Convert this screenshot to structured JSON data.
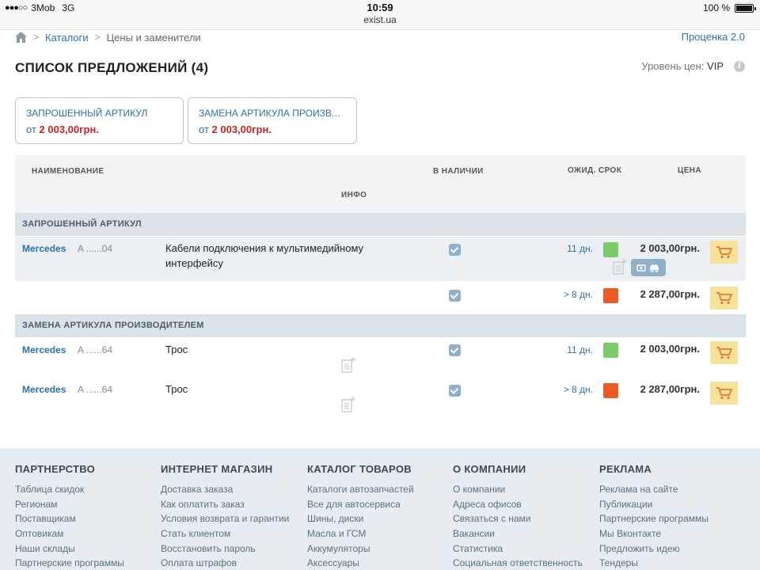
{
  "status": {
    "carrier": "3Mob",
    "network": "3G",
    "time": "10:59",
    "url": "exist.ua",
    "battery": "100 %"
  },
  "breadcrumb": {
    "items": [
      "Каталоги",
      "Цены и заменители"
    ],
    "right_link": "Проценка 2.0"
  },
  "header": {
    "title": "СПИСОК ПРЕДЛОЖЕНИЙ (4)",
    "price_level_label": "Уровень цен:",
    "price_level_value": "VIP"
  },
  "cards": [
    {
      "title": "ЗАПРОШЕННЫЙ АРТИКУЛ",
      "price_prefix": "от",
      "price": "2 003,00грн."
    },
    {
      "title": "ЗАМЕНА АРТИКУЛА ПРОИЗВОД...",
      "price_prefix": "от",
      "price": "2 003,00грн."
    }
  ],
  "table": {
    "columns": {
      "name": "НАИМЕНОВАНИЕ",
      "stock": "В НАЛИЧИИ",
      "term": "ОЖИД. СРОК",
      "price": "ЦЕНА",
      "info": "ИНФО"
    },
    "groups": [
      {
        "title": "ЗАПРОШЕННЫЙ АРТИКУЛ",
        "rows": [
          {
            "brand": "Mercedes",
            "sku": "A ......04",
            "description": "Кабели подключения к мультимедийному интерфейсу",
            "term": "11 дн.",
            "status_color": "#7ccb6b",
            "price": "2 003,00грн.",
            "in_stock": true
          },
          {
            "brand": "",
            "sku": "",
            "description": "",
            "term": "> 8 дн.",
            "status_color": "#ea5a25",
            "price": "2 287,00грн.",
            "in_stock": true
          }
        ]
      },
      {
        "title": "ЗАМЕНА АРТИКУЛА ПРОИЗВОДИТЕЛЕМ",
        "rows": [
          {
            "brand": "Mercedes",
            "sku": "A ......64",
            "description": "Трос",
            "term": "11 дн.",
            "status_color": "#7ccb6b",
            "price": "2 003,00грн.",
            "in_stock": true
          },
          {
            "brand": "Mercedes",
            "sku": "A ......64",
            "description": "Трос",
            "term": "> 8 дн.",
            "status_color": "#ea5a25",
            "price": "2 287,00грн.",
            "in_stock": true
          }
        ]
      }
    ]
  },
  "footer": {
    "columns": [
      {
        "title": "ПАРТНЕРСТВО",
        "links": [
          "Таблица скидок",
          "Регионам",
          "Поставщикам",
          "Оптовикам",
          "Наши склады",
          "Партнерские программы"
        ]
      },
      {
        "title": "ИНТЕРНЕТ МАГАЗИН",
        "links": [
          "Доставка заказа",
          "Как оплатить заказ",
          "Условия возврата и гарантии",
          "Стать клиентом",
          "Восстановить пароль",
          "Оплата штрафов"
        ]
      },
      {
        "title": "КАТАЛОГ ТОВАРОВ",
        "links": [
          "Каталоги автозапчастей",
          "Все для автосервиса",
          "Шины, диски",
          "Масла и ГСМ",
          "Аккумуляторы",
          "Аксессуары"
        ]
      },
      {
        "title": "О КОМПАНИИ",
        "links": [
          "О компании",
          "Адреса офисов",
          "Связаться с нами",
          "Вакансии",
          "Статистика",
          "Социальная ответственность"
        ]
      },
      {
        "title": "РЕКЛАМА",
        "links": [
          "Реклама на сайте",
          "Публикации",
          "Партнерские программы",
          "Мы Вконтакте",
          "Предложить идею",
          "Тендеры"
        ]
      }
    ]
  },
  "colors": {
    "link": "#2e6fa7",
    "price_red": "#c9231d",
    "in_time": "#7ccb6b",
    "late": "#ea5a25",
    "cart_bg": "#f6e29a",
    "group_bg": "#dbe3e8",
    "footer_bg": "#e6ecef"
  }
}
